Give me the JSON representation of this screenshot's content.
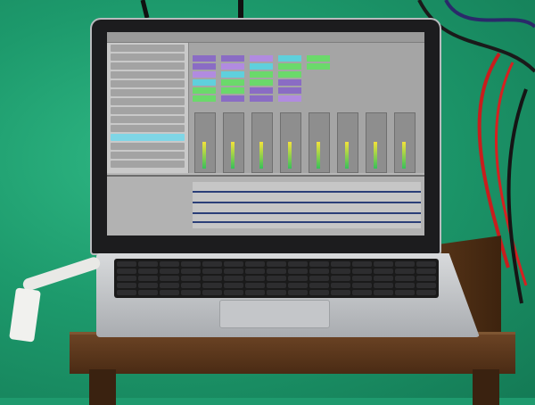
{
  "scene": {
    "description_free": true,
    "colors": {
      "backdrop": "#1f9a6e",
      "accent_purple": "#8a6cc4",
      "accent_cyan": "#5fd0dc",
      "accent_green": "#6bd96b",
      "accent_orange": "#f0a23a"
    },
    "icons": [
      "laptop-icon",
      "keyboard-icon",
      "trackpad-icon",
      "usb-dongle-icon"
    ]
  },
  "screen": {
    "clip_colors": [
      "#8a6cc4",
      "#8a6cc4",
      "#b18be0",
      "#5fd0dc",
      "#6bd96b",
      "#6bd96b"
    ],
    "browser_items": 14,
    "mixer_strips": 8
  }
}
